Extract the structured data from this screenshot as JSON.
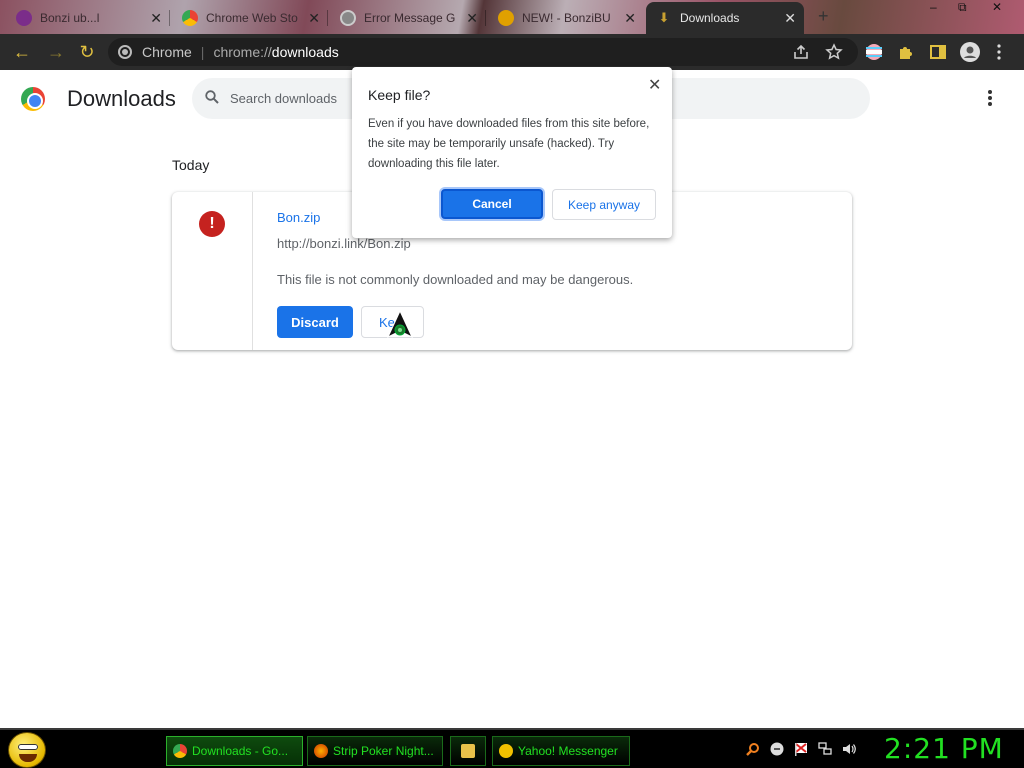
{
  "browser": {
    "tabs": [
      {
        "label": "Bonzi ub...l"
      },
      {
        "label": "Chrome Web Sto"
      },
      {
        "label": "Error Message G"
      },
      {
        "label": "NEW! - BonziBU"
      },
      {
        "label": "Downloads"
      }
    ],
    "window_controls": {
      "minimize": "–",
      "maximize": "⧉",
      "close": "✕"
    },
    "omnibox": {
      "site_name": "Chrome",
      "scheme": "chrome://",
      "host": "downloads"
    }
  },
  "page": {
    "title": "Downloads",
    "search_placeholder": "Search downloads",
    "date_header": "Today"
  },
  "download": {
    "file_name": "Bon.zip",
    "url": "http://bonzi.link/Bon.zip",
    "warning": "This file is not commonly downloaded and may be dangerous.",
    "danger_glyph": "!",
    "discard_label": "Discard",
    "keep_label": "Kee"
  },
  "dialog": {
    "title": "Keep file?",
    "body": "Even if you have downloaded files from this site before, the site may be temporarily unsafe (hacked). Try downloading this file later.",
    "cancel_label": "Cancel",
    "keep_anyway_label": "Keep anyway",
    "close_glyph": "✕"
  },
  "taskbar": {
    "items": [
      {
        "label": "Downloads - Go..."
      },
      {
        "label": "Strip Poker Night..."
      },
      {
        "label": "Yahoo! Messenger"
      }
    ],
    "clock": "2:21 PM"
  },
  "colors": {
    "accent": "#1a73e8",
    "danger": "#c5221f",
    "toolbar_bg": "#2b2b2b",
    "taskbar_text": "#22e022"
  },
  "icons": {
    "tab_favicons": [
      "bonzi-icon",
      "chrome-web-store-icon",
      "error-page-icon",
      "bonzi-buddy-icon",
      "download-icon"
    ],
    "toolbar": [
      "back-icon",
      "forward-icon",
      "reload-icon",
      "share-icon",
      "bookmark-star-icon",
      "profile-flag-icon",
      "extensions-icon",
      "side-panel-icon",
      "account-icon"
    ],
    "tray": [
      "search-icon",
      "messenger-icon",
      "flag-icon",
      "network-icon",
      "volume-icon"
    ]
  }
}
